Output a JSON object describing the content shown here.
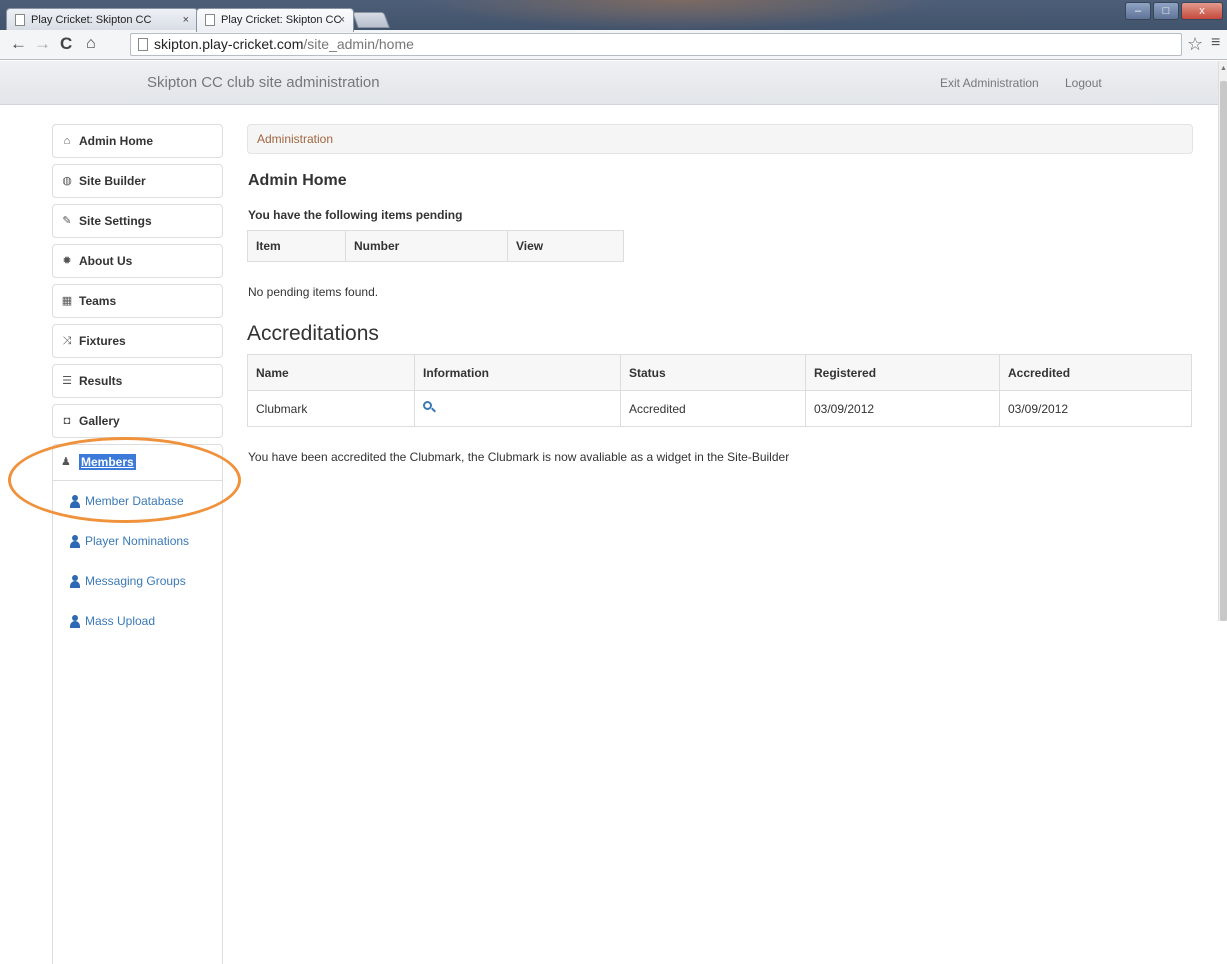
{
  "browser": {
    "tabs": [
      {
        "label": "Play Cricket: Skipton CC"
      },
      {
        "label": "Play Cricket: Skipton CC"
      }
    ],
    "tab_close": "×",
    "url_host": "skipton.play-cricket.com",
    "url_path": "/site_admin/home",
    "window_buttons": {
      "minimize": "–",
      "maximize": "□",
      "close": "x"
    }
  },
  "header": {
    "title": "Skipton CC club site administration",
    "exit_admin": "Exit Administration",
    "logout": "Logout"
  },
  "sidebar": {
    "items": [
      {
        "label": "Admin Home",
        "icon": "home-icon"
      },
      {
        "label": "Site Builder",
        "icon": "globe-icon"
      },
      {
        "label": "Site Settings",
        "icon": "wrench-icon"
      },
      {
        "label": "About Us",
        "icon": "cog-icon"
      },
      {
        "label": "Teams",
        "icon": "grid-icon"
      },
      {
        "label": "Fixtures",
        "icon": "shuffle-icon"
      },
      {
        "label": "Results",
        "icon": "list-icon"
      },
      {
        "label": "Gallery",
        "icon": "camera-icon"
      }
    ],
    "members": {
      "label": "Members",
      "icon": "user-icon",
      "subitems": [
        {
          "label": "Member Database"
        },
        {
          "label": "Player Nominations"
        },
        {
          "label": "Messaging Groups"
        },
        {
          "label": "Mass Upload"
        }
      ]
    }
  },
  "main": {
    "breadcrumb": "Administration",
    "heading": "Admin Home",
    "pending_heading": "You have the following items pending",
    "pending_columns": [
      "Item",
      "Number",
      "View"
    ],
    "no_pending": "No pending items found.",
    "accreditations_heading": "Accreditations",
    "accred_columns": [
      "Name",
      "Information",
      "Status",
      "Registered",
      "Accredited"
    ],
    "accred_rows": [
      {
        "name": "Clubmark",
        "information_icon": "zoom-icon",
        "status": "Accredited",
        "registered": "03/09/2012",
        "accredited": "03/09/2012"
      }
    ],
    "note": "You have been accredited the Clubmark, the Clubmark is now avaliable as a widget in the Site-Builder"
  },
  "colors": {
    "link": "#3a79b5",
    "breadcrumb": "#a0663f",
    "highlight_ring": "#f0913b",
    "selection": "#3b7ad9"
  }
}
